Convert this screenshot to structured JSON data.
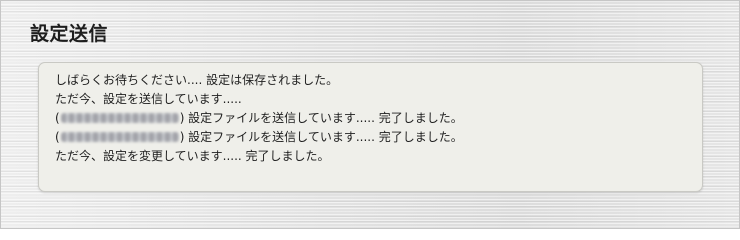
{
  "page": {
    "title": "設定送信"
  },
  "log": {
    "lines": [
      {
        "text": "しばらくお待ちください.... 設定は保存されました。"
      },
      {
        "text": "ただ今、設定を送信しています....."
      },
      {
        "prefix": "(",
        "masked_value": "•• •• ••• ••• ••",
        "suffix": ") 設定ファイルを送信しています..... 完了しました。"
      },
      {
        "prefix": "(",
        "masked_value": "•• •• ••• ••• ••",
        "suffix": ") 設定ファイルを送信しています..... 完了しました。"
      },
      {
        "text": "ただ今、設定を変更しています..... 完了しました。"
      }
    ]
  }
}
